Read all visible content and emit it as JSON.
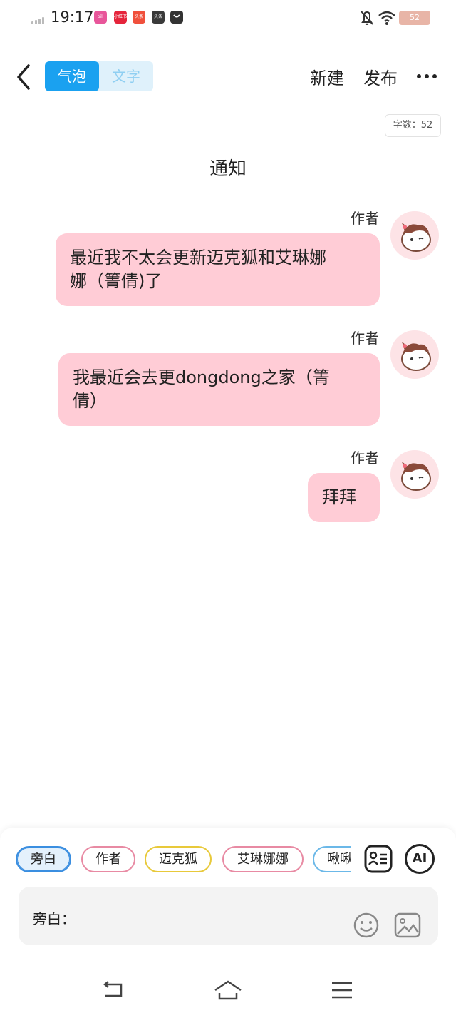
{
  "status_bar": {
    "time": "19:17",
    "app_icons": [
      {
        "name": "bilibili-icon",
        "color": "#e8569a"
      },
      {
        "name": "xiaohongshu-icon",
        "color": "#e5243b"
      },
      {
        "name": "toutiao-icon",
        "color": "#e8333a"
      },
      {
        "name": "toutiao-alt-icon",
        "color": "#333333"
      },
      {
        "name": "shopping-bag-icon",
        "color": "#333333"
      }
    ],
    "battery": "52"
  },
  "toolbar": {
    "mode_tabs": [
      "气泡",
      "文字"
    ],
    "active_tab": "气泡",
    "new_label": "新建",
    "publish_label": "发布"
  },
  "editor": {
    "word_count": "字数：52",
    "title": "通知",
    "messages": [
      {
        "speaker": "作者",
        "text_line1": "最近我不太会更新迈克狐和艾琳娜",
        "text_line2": "娜（箐倩)了"
      },
      {
        "speaker": "作者",
        "text_line1": "我最近会去更dongdong之家（箐",
        "text_line2": "倩）"
      },
      {
        "speaker": "作者",
        "text_line1": "拜拜",
        "text_line2": ""
      }
    ]
  },
  "input_panel": {
    "roles": [
      {
        "label": "旁白",
        "color": "#3a8ee0",
        "selected": true
      },
      {
        "label": "作者",
        "color": "#e88aa3",
        "selected": false
      },
      {
        "label": "迈克狐",
        "color": "#e8c93a",
        "selected": false
      },
      {
        "label": "艾琳娜娜",
        "color": "#e88aa3",
        "selected": false
      },
      {
        "label": "啾啾",
        "color": "#6bb8e8",
        "selected": false
      }
    ],
    "ai_label": "AI",
    "input_prefix": "旁白："
  },
  "colors": {
    "accent": "#1aa1f0",
    "bubble": "#ffccd6"
  }
}
